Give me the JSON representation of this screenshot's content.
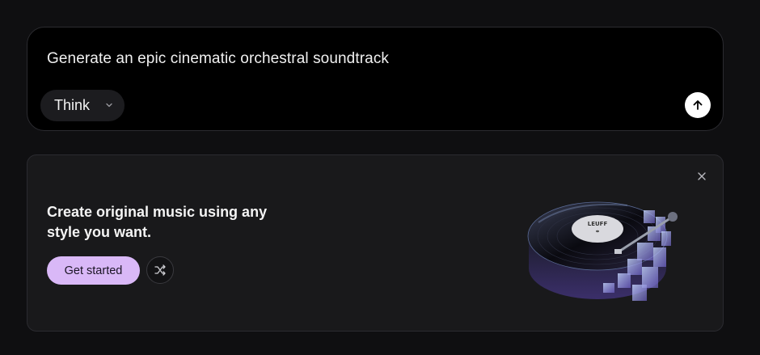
{
  "prompt": {
    "text": "Generate an epic cinematic orchestral soundtrack",
    "mode_label": "Think",
    "mode_icon": "chevron-down-icon",
    "send_icon": "arrow-up-icon"
  },
  "promo": {
    "title": "Create original music using any style you want.",
    "cta_label": "Get started",
    "shuffle_icon": "shuffle-icon",
    "close_icon": "close-icon",
    "illustration": "vinyl-turntable-illustration",
    "record_label_text": "LEUFF",
    "accent_color": "#d9b8f7"
  }
}
